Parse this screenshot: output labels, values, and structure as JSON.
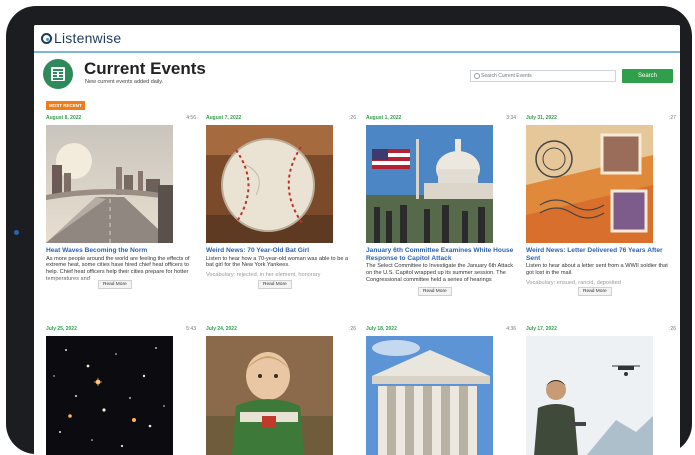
{
  "app": {
    "logo": "Listenwise"
  },
  "header": {
    "title": "Current Events",
    "subtitle": "New current events added daily.",
    "search_placeholder": "Search Current Events",
    "search_button": "Search"
  },
  "badge": "MOST RECENT",
  "read_more": "Read More",
  "cards": [
    {
      "date": "August 8, 2022",
      "duration": "4:56",
      "title": "Heat Waves Becoming the Norm",
      "description": "As more people around the world are feeling the effects of extreme heat, some cities have hired chief heat officers to help. Chief heat officers help their cities prepare for hotter temperatures and"
    },
    {
      "date": "August 7, 2022",
      "duration": ":26",
      "title": "Weird News: 70 Year-Old Bat Girl",
      "description": "Listen to hear how a 70-year-old woman was able to be a bat girl for the New York Yankees.",
      "vocabulary": "Vocabulary: rejected, in her element, honorary"
    },
    {
      "date": "August 1, 2022",
      "duration": "3:34",
      "title": "January 6th Committee Examines White House Response to Capitol Attack",
      "description": "The Select Committee to Investigate the January 6th Attack on the U.S. Capitol wrapped up its summer session. The Congressional committee held a series of hearings"
    },
    {
      "date": "July 31, 2022",
      "duration": ":27",
      "title": "Weird News: Letter Delivered 76 Years After Sent",
      "description": "Listen to hear about a letter sent from a WWII soldier that got lost in the mail.",
      "vocabulary": "Vocabulary: ensued, rancid, deposited"
    },
    {
      "date": "July 25, 2022",
      "duration": "5:43"
    },
    {
      "date": "July 24, 2022",
      "duration": ":26"
    },
    {
      "date": "July 18, 2022",
      "duration": "4:36"
    },
    {
      "date": "July 17, 2022",
      "duration": ":26"
    }
  ],
  "colors": {
    "accent_green": "#2f9f4b",
    "link_blue": "#2a63b5",
    "badge_orange": "#ef7e1a",
    "icon_green": "#2f8a5b"
  },
  "icons": [
    "listenwise-logo",
    "newspaper-icon",
    "search-icon"
  ]
}
